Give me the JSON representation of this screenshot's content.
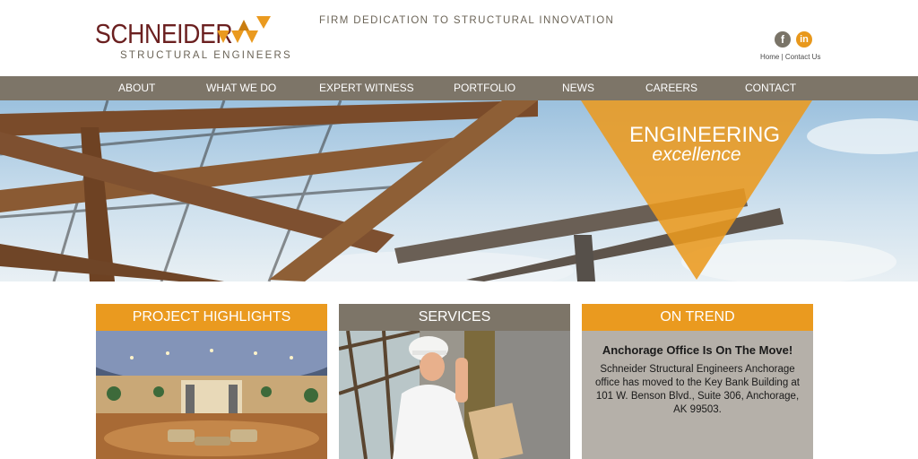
{
  "brand": {
    "name": "SCHNEIDER",
    "subtitle": "STRUCTURAL ENGINEERS",
    "tagline": "FIRM DEDICATION TO STRUCTURAL INNOVATION"
  },
  "social": {
    "facebook": "f",
    "linkedin": "in"
  },
  "top_links": {
    "home": "Home",
    "separator": " | ",
    "contact": "Contact Us"
  },
  "nav": {
    "items": [
      "ABOUT",
      "WHAT WE DO",
      "EXPERT WITNESS",
      "PORTFOLIO",
      "NEWS",
      "CAREERS",
      "CONTACT"
    ]
  },
  "hero": {
    "title": "ENGINEERING",
    "subtitle": "excellence"
  },
  "cards": [
    {
      "heading": "PROJECT HIGHLIGHTS"
    },
    {
      "heading": "SERVICES"
    },
    {
      "heading": "ON TREND",
      "news_title": "Anchorage Office Is On The Move!",
      "news_body": "Schneider Structural Engineers Anchorage office has moved to the Key Bank Building at 101 W. Benson Blvd., Suite 306, Anchorage, AK 99503."
    }
  ],
  "colors": {
    "brand_red": "#6b2020",
    "accent_orange": "#ea9a1f",
    "nav_gray": "#7d7568",
    "panel_gray": "#b5b0a9"
  }
}
